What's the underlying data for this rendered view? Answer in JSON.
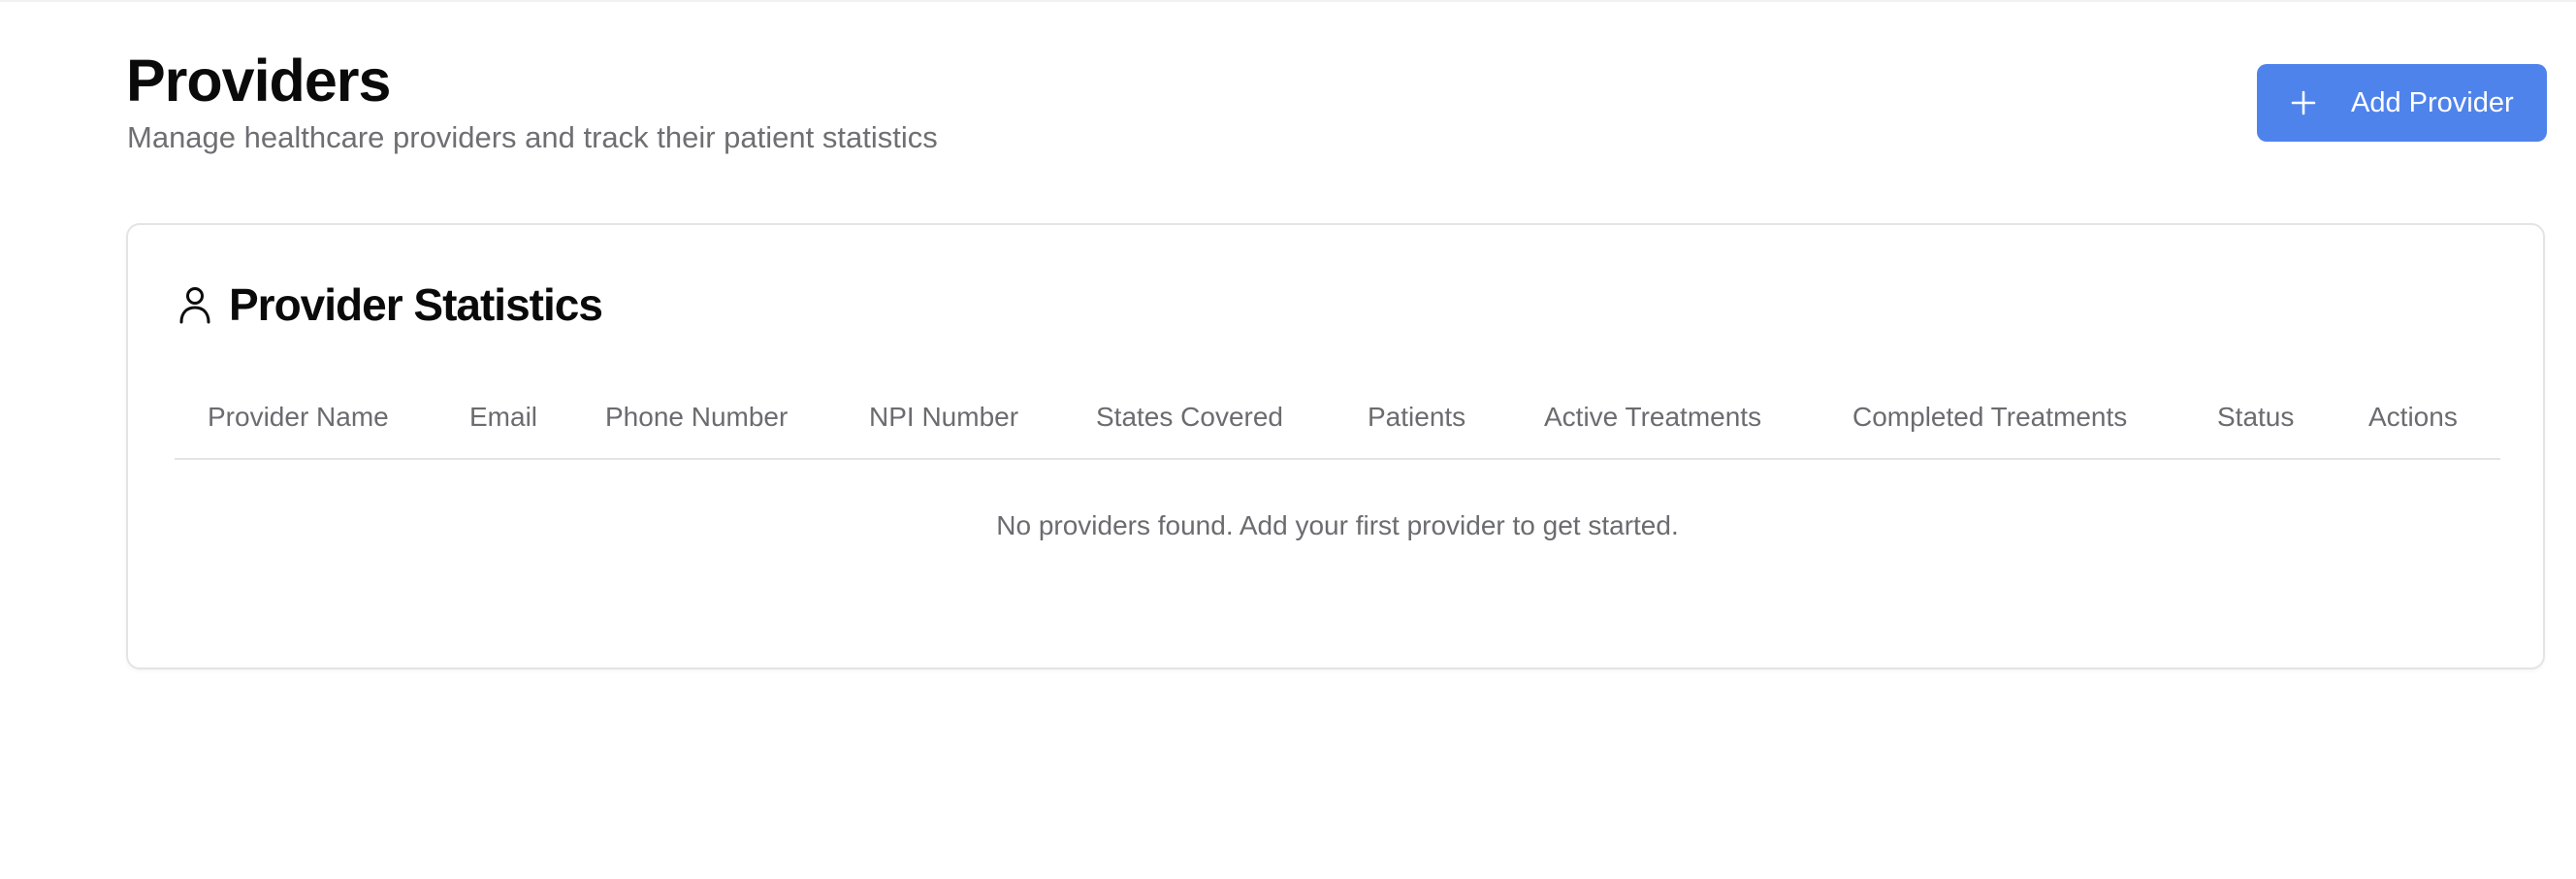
{
  "header": {
    "title": "Providers",
    "subtitle": "Manage healthcare providers and track their patient statistics",
    "add_button_label": "Add Provider"
  },
  "card": {
    "title": "Provider Statistics",
    "icon": "user-icon"
  },
  "table": {
    "columns": [
      "Provider Name",
      "Email",
      "Phone Number",
      "NPI Number",
      "States Covered",
      "Patients",
      "Active Treatments",
      "Completed Treatments",
      "Status",
      "Actions"
    ],
    "rows": [],
    "empty_message": "No providers found. Add your first provider to get started."
  },
  "colors": {
    "accent": "#4f83ec",
    "muted_text": "#6b6b70",
    "border": "#e4e4e7"
  }
}
